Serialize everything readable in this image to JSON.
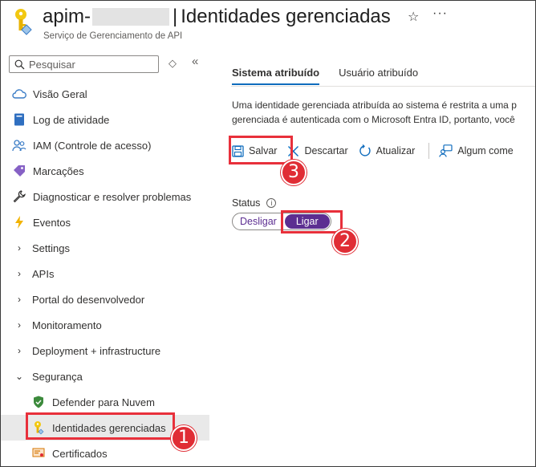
{
  "header": {
    "title_prefix": "apim-",
    "title_separator": "|",
    "title": "Identidades gerenciadas",
    "subtitle": "Serviço de Gerenciamento de API",
    "star_icon": "☆",
    "more_icon": "···"
  },
  "sidebar": {
    "search_placeholder": "Pesquisar",
    "expand_icon": "◇",
    "collapse_icon": "«",
    "items": [
      {
        "label": "Visão Geral"
      },
      {
        "label": "Log de atividade"
      },
      {
        "label": "IAM (Controle de acesso)"
      },
      {
        "label": "Marcações"
      },
      {
        "label": "Diagnosticar e resolver problemas"
      },
      {
        "label": "Eventos"
      },
      {
        "label": "Settings"
      },
      {
        "label": "APIs"
      },
      {
        "label": "Portal do desenvolvedor"
      },
      {
        "label": "Monitoramento"
      },
      {
        "label": "Deployment + infrastructure"
      },
      {
        "label": "Segurança"
      },
      {
        "label": "Defender para Nuvem"
      },
      {
        "label": "Identidades gerenciadas"
      },
      {
        "label": "Certificados"
      }
    ]
  },
  "main": {
    "tabs": [
      {
        "label": "Sistema atribuído"
      },
      {
        "label": "Usuário atribuído"
      }
    ],
    "description_line1": "Uma identidade gerenciada atribuída ao sistema é restrita a uma p",
    "description_line2": "gerenciada é autenticada com o Microsoft Entra ID, portanto, você",
    "toolbar": {
      "save": "Salvar",
      "discard": "Descartar",
      "refresh": "Atualizar",
      "feedback": "Algum come"
    },
    "status": {
      "label": "Status",
      "info_icon": "i",
      "off": "Desligar",
      "on": "Ligar"
    }
  },
  "annotations": {
    "step1": "1",
    "step2": "2",
    "step3": "3"
  },
  "colors": {
    "accent_purple": "#5c2e91",
    "tab_underline": "#0f6cbd",
    "annotation_red": "#e02d35"
  }
}
